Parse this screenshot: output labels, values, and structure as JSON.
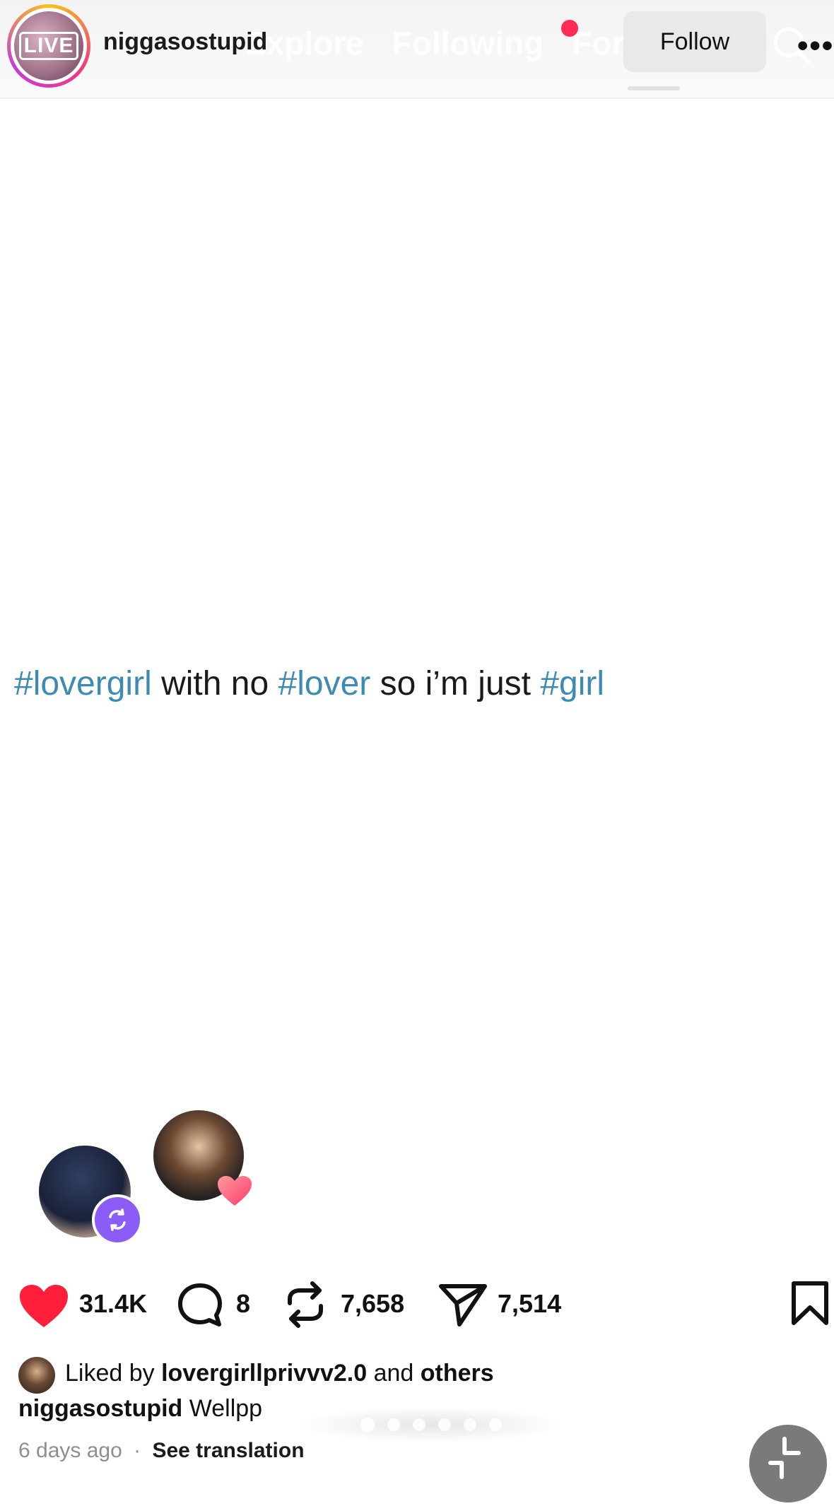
{
  "header": {
    "live_label": "LIVE",
    "username": "niggasostupid",
    "follow_label": "Follow",
    "ghost_tabs": [
      "Explore",
      "Following",
      "For You"
    ]
  },
  "post": {
    "tag1": "#lovergirl",
    "text1": "with no",
    "tag2": "#lover",
    "text2": "so i’m just",
    "tag3": "#girl"
  },
  "actions": {
    "likes": "31.4K",
    "comments": "8",
    "reposts": "7,658",
    "shares": "7,514"
  },
  "liked_by": {
    "prefix": "Liked by",
    "user": "lovergirllprivvv2.0",
    "and": "and",
    "others": "others"
  },
  "caption": {
    "username": "niggasostupid",
    "text": "Wellpp"
  },
  "meta": {
    "time": "6 days ago",
    "separator": "·",
    "translate": "See translation"
  },
  "colors": {
    "hashtag": "#3d8bb3",
    "like": "#ff1f3d",
    "repost_badge": "#8b5cf6",
    "live_dot": "#ff2d55"
  },
  "icons": [
    "search-icon",
    "more-icon",
    "heart-icon",
    "comment-icon",
    "repost-icon",
    "share-icon",
    "bookmark-icon"
  ]
}
